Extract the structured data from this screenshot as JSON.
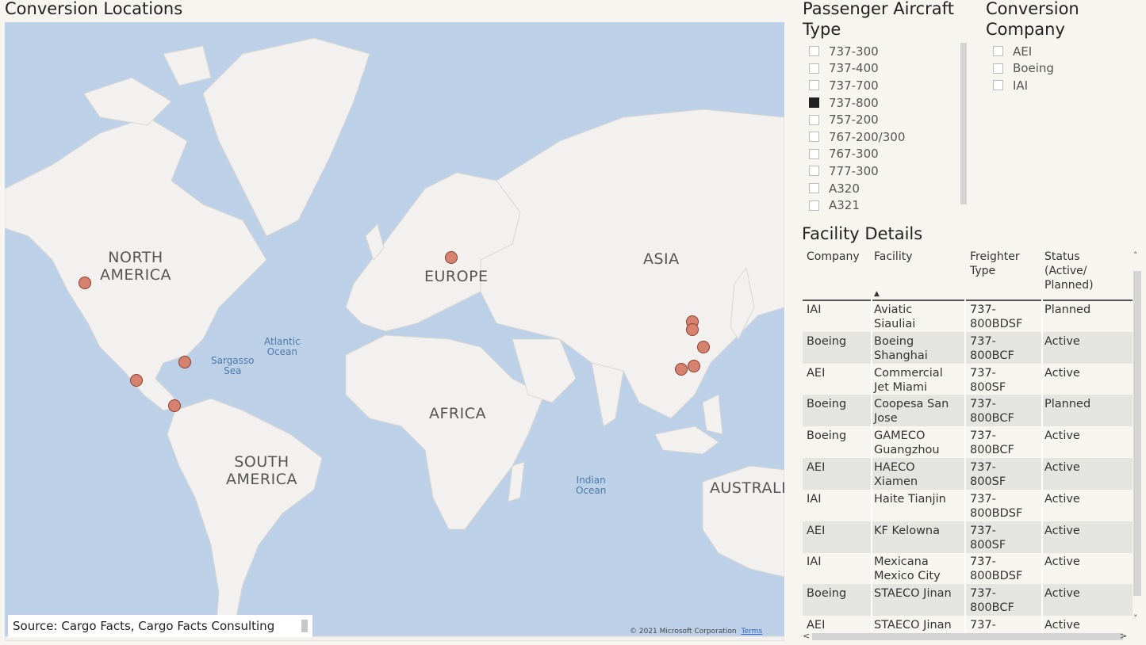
{
  "map": {
    "title": "Conversion Locations",
    "continents": [
      "NORTH\nAMERICA",
      "EUROPE",
      "ASIA",
      "AFRICA",
      "SOUTH\nAMERICA",
      "AUSTRALIA"
    ],
    "seas": [
      "Atlantic\nOcean",
      "Sargasso\nSea",
      "Indian\nOcean"
    ],
    "source": "Source: Cargo Facts, Cargo Facts Consulting",
    "copyright": "© 2021 Microsoft Corporation",
    "terms": "Terms",
    "colors": {
      "water": "#bcd1e8",
      "land": "#f3f1ef",
      "pin": "#d6826e"
    }
  },
  "aircraft_slicer": {
    "title": "Passenger Aircraft\nType",
    "items": [
      {
        "label": "737-300",
        "checked": false
      },
      {
        "label": "737-400",
        "checked": false
      },
      {
        "label": "737-700",
        "checked": false
      },
      {
        "label": "737-800",
        "checked": true
      },
      {
        "label": "757-200",
        "checked": false
      },
      {
        "label": "767-200/300",
        "checked": false
      },
      {
        "label": "767-300",
        "checked": false
      },
      {
        "label": "777-300",
        "checked": false
      },
      {
        "label": "A320",
        "checked": false
      },
      {
        "label": "A321",
        "checked": false
      }
    ]
  },
  "company_slicer": {
    "title": "Conversion\nCompany",
    "items": [
      {
        "label": "AEI",
        "checked": false
      },
      {
        "label": "Boeing",
        "checked": false
      },
      {
        "label": "IAI",
        "checked": false
      }
    ]
  },
  "facility_table": {
    "title": "Facility Details",
    "headers": [
      "Company",
      "Facility",
      "Freighter\nType",
      "Status\n(Active/\nPlanned)"
    ],
    "sort_indicator": "▲",
    "rows": [
      [
        "IAI",
        "Aviatic\nSiauliai",
        "737-\n800BDSF",
        "Planned"
      ],
      [
        "Boeing",
        "Boeing\nShanghai",
        "737-\n800BCF",
        "Active"
      ],
      [
        "AEI",
        "Commercial\nJet Miami",
        "737-\n800SF",
        "Active"
      ],
      [
        "Boeing",
        "Coopesa San\nJose",
        "737-\n800BCF",
        "Planned"
      ],
      [
        "Boeing",
        "GAMECO\nGuangzhou",
        "737-\n800BCF",
        "Active"
      ],
      [
        "AEI",
        "HAECO\nXiamen",
        "737-\n800SF",
        "Active"
      ],
      [
        "IAI",
        "Haite Tianjin",
        "737-\n800BDSF",
        "Active"
      ],
      [
        "AEI",
        "KF Kelowna",
        "737-\n800SF",
        "Active"
      ],
      [
        "IAI",
        "Mexicana\nMexico City",
        "737-\n800BDSF",
        "Active"
      ],
      [
        "Boeing",
        "STAECO Jinan",
        "737-\n800BCF",
        "Active"
      ],
      [
        "AEI",
        "STAECO Jinan",
        "737-",
        "Active"
      ]
    ]
  }
}
